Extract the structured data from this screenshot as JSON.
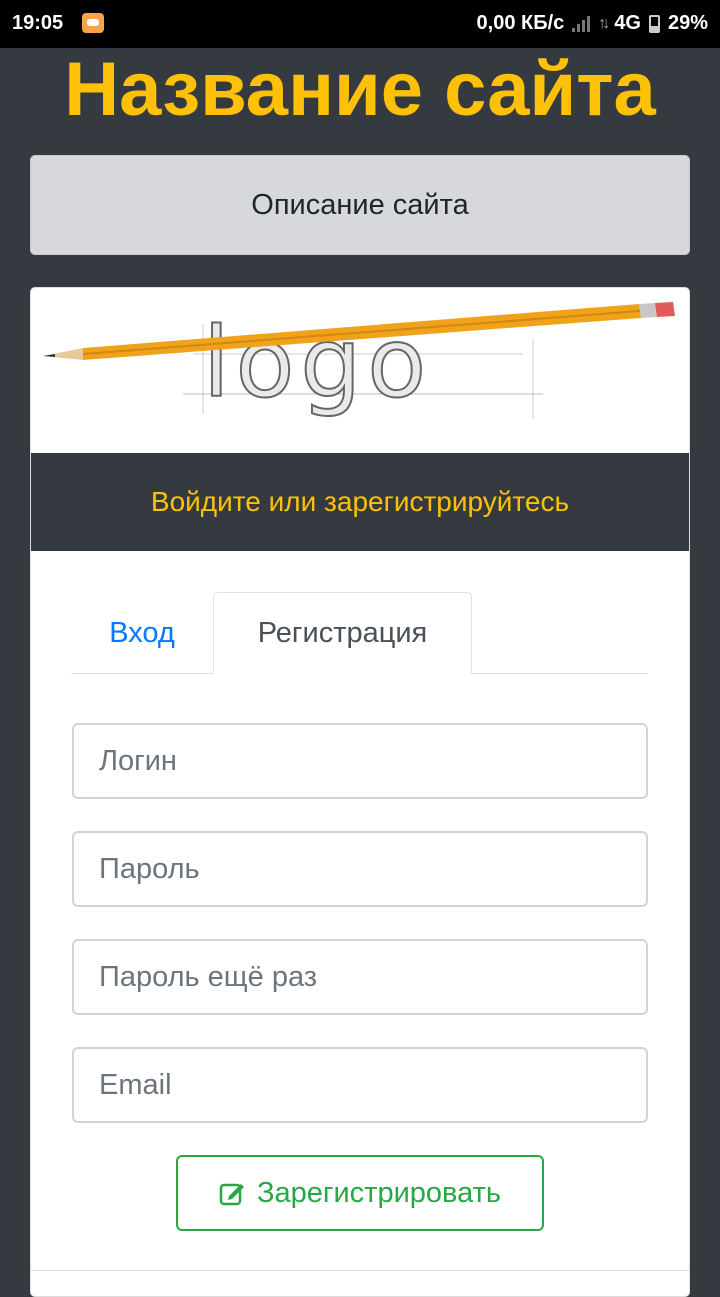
{
  "status_bar": {
    "time": "19:05",
    "net_speed": "0,00 КБ/с",
    "network": "4G",
    "battery": "29%"
  },
  "header": {
    "site_title": "Название сайта",
    "description": "Описание сайта"
  },
  "logo": {
    "text": "logo"
  },
  "auth": {
    "banner": "Войдите или зарегистрируйтесь",
    "tabs": [
      {
        "label": "Вход",
        "active": false
      },
      {
        "label": "Регистрация",
        "active": true
      }
    ],
    "fields": {
      "login_placeholder": "Логин",
      "password_placeholder": "Пароль",
      "password_repeat_placeholder": "Пароль ещё раз",
      "email_placeholder": "Email"
    },
    "submit_label": "Зарегистрировать"
  },
  "colors": {
    "accent": "#ffc107",
    "page_bg": "#343a40",
    "link": "#007bff",
    "success": "#28a745"
  }
}
